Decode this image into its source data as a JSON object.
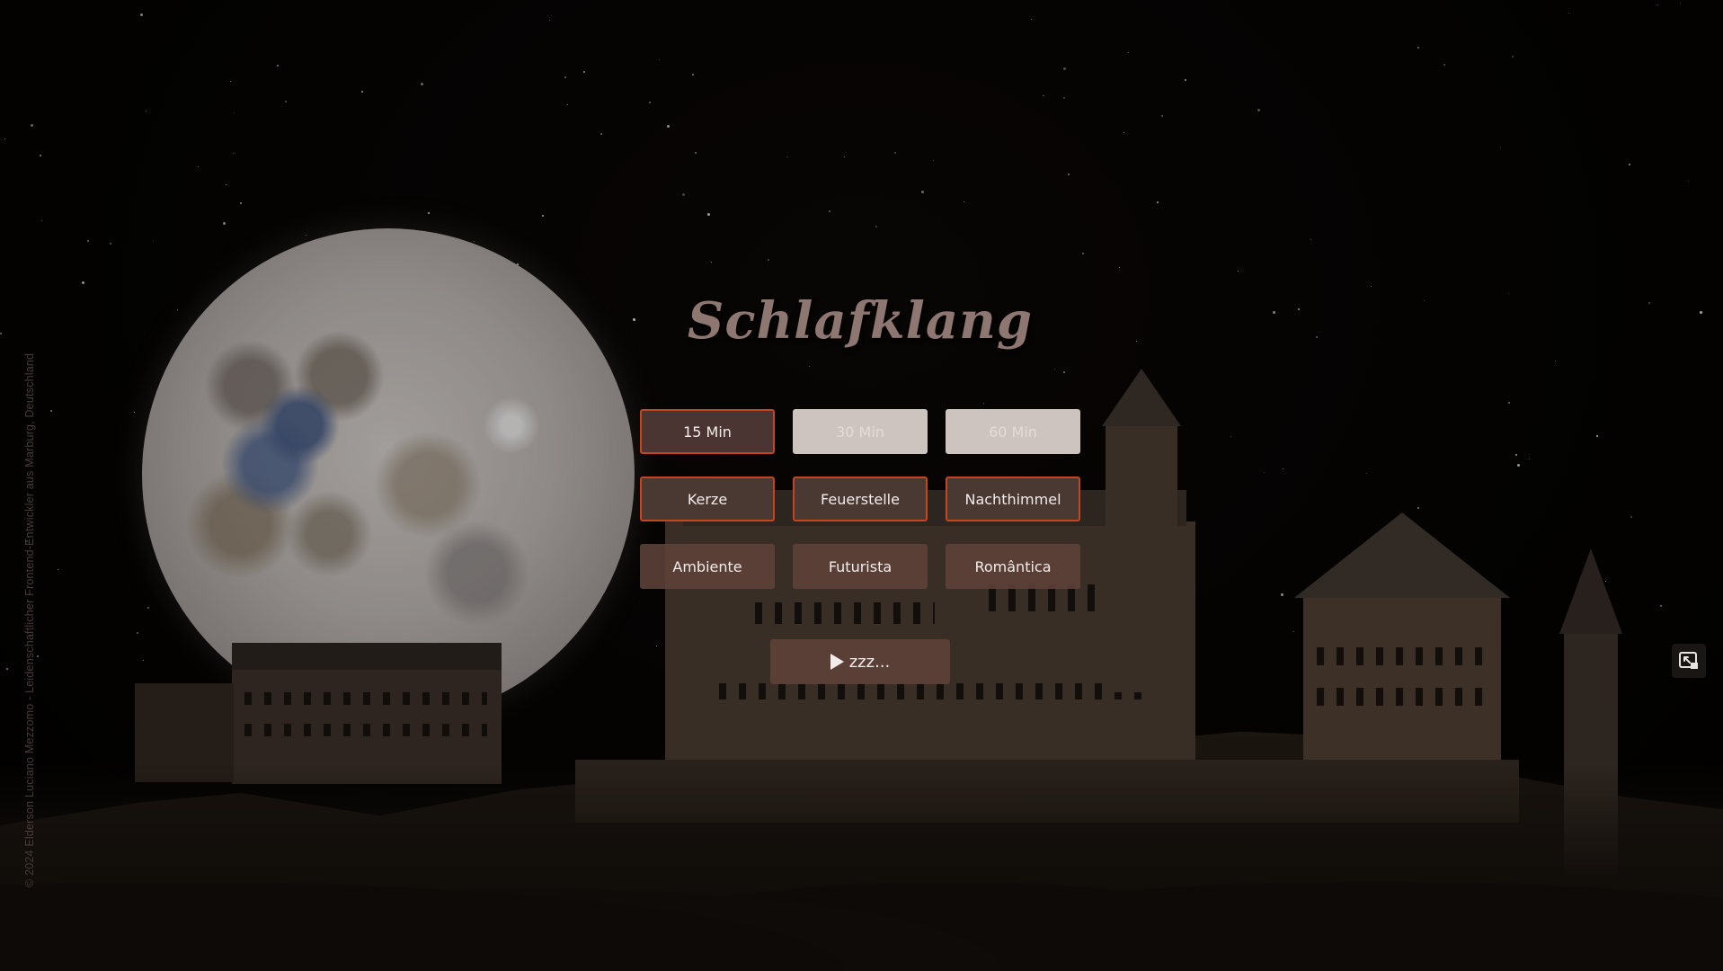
{
  "app": {
    "title": "Schlafklang",
    "credit": "© 2024 Elderson Luciano Mezzomo - Leidenschaftlicher Frontend-Entwickler aus Marburg, Deutschland"
  },
  "timer": {
    "options": [
      {
        "label": "15 Min",
        "active": true
      },
      {
        "label": "30 Min",
        "active": false
      },
      {
        "label": "60 Min",
        "active": false
      }
    ]
  },
  "sounds": {
    "options": [
      {
        "label": "Kerze"
      },
      {
        "label": "Feuerstelle"
      },
      {
        "label": "Nachthimmel"
      }
    ]
  },
  "themes": {
    "options": [
      {
        "label": "Ambiente"
      },
      {
        "label": "Futurista"
      },
      {
        "label": "Romântica"
      }
    ]
  },
  "play": {
    "label": "zzz...",
    "icon": "play-icon"
  },
  "fullscreen": {
    "icon": "fullscreen-icon"
  },
  "colors": {
    "accent_border": "#c2461f",
    "button_bg": "#4b3532",
    "inactive_bg": "#cdc3bf",
    "title": "#8f7771"
  }
}
